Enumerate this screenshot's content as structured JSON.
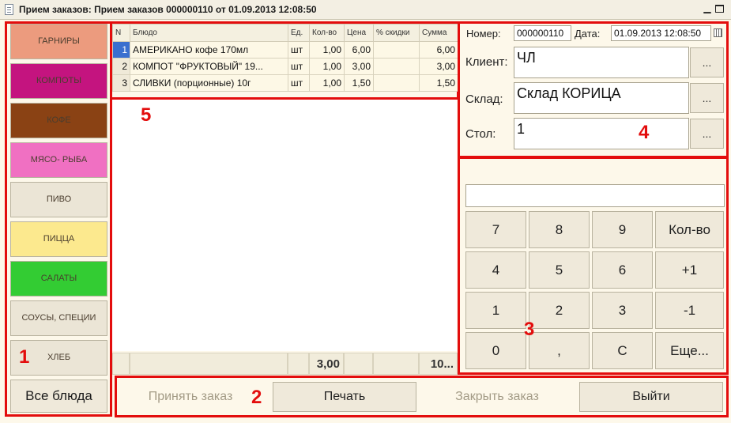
{
  "window": {
    "title": "Прием заказов: Прием заказов 000000110 от 01.09.2013 12:08:50"
  },
  "categories": [
    {
      "label": "ГАРНИРЫ",
      "color": "#ec9b7e"
    },
    {
      "label": "КОМПОТЫ",
      "color": "#c4147f"
    },
    {
      "label": "КОФЕ",
      "color": "#8a4214"
    },
    {
      "label": "МЯСО- РЫБА",
      "color": "#f070c2"
    },
    {
      "label": "ПИВО",
      "color": "#ebe5d6"
    },
    {
      "label": "ПИЦЦА",
      "color": "#fce98e"
    },
    {
      "label": "САЛАТЫ",
      "color": "#33cc33"
    },
    {
      "label": "СОУСЫ, СПЕЦИИ",
      "color": "#ebe5d6"
    },
    {
      "label": "ХЛЕБ",
      "color": "#ebe5d6"
    }
  ],
  "all_dishes_label": "Все блюда",
  "table": {
    "headers": [
      "N",
      "Блюдо",
      "Ед.",
      "Кол-во",
      "Цена",
      "% скидки",
      "Сумма"
    ],
    "rows": [
      [
        "1",
        "АМЕРИКАНО кофе 170мл",
        "шт",
        "1,00",
        "6,00",
        "",
        "6,00"
      ],
      [
        "2",
        "КОМПОТ \"ФРУКТОВЫЙ\" 19...",
        "шт",
        "1,00",
        "3,00",
        "",
        "3,00"
      ],
      [
        "3",
        "СЛИВКИ (порционные) 10г",
        "шт",
        "1,00",
        "1,50",
        "",
        "1,50"
      ]
    ],
    "footer": {
      "qty_total": "3,00",
      "sum_total": "10..."
    }
  },
  "order": {
    "number_label": "Номер:",
    "number": "000000110",
    "date_label": "Дата:",
    "date": "01.09.2013 12:08:50",
    "client_label": "Клиент:",
    "client": "ЧЛ",
    "warehouse_label": "Склад:",
    "warehouse": "Склад КОРИЦА",
    "table_label": "Стол:",
    "table": "1",
    "dots": "..."
  },
  "keypad": {
    "display": "",
    "keys": [
      "7",
      "8",
      "9",
      "Кол-во",
      "4",
      "5",
      "6",
      "+1",
      "1",
      "2",
      "3",
      "-1",
      "0",
      ",",
      "C",
      "Еще..."
    ]
  },
  "actions": {
    "accept": "Принять заказ",
    "print": "Печать",
    "close": "Закрыть заказ",
    "exit": "Выйти"
  },
  "zone_labels": [
    "1",
    "2",
    "3",
    "4",
    "5"
  ],
  "accent_color": "#e30d0d"
}
